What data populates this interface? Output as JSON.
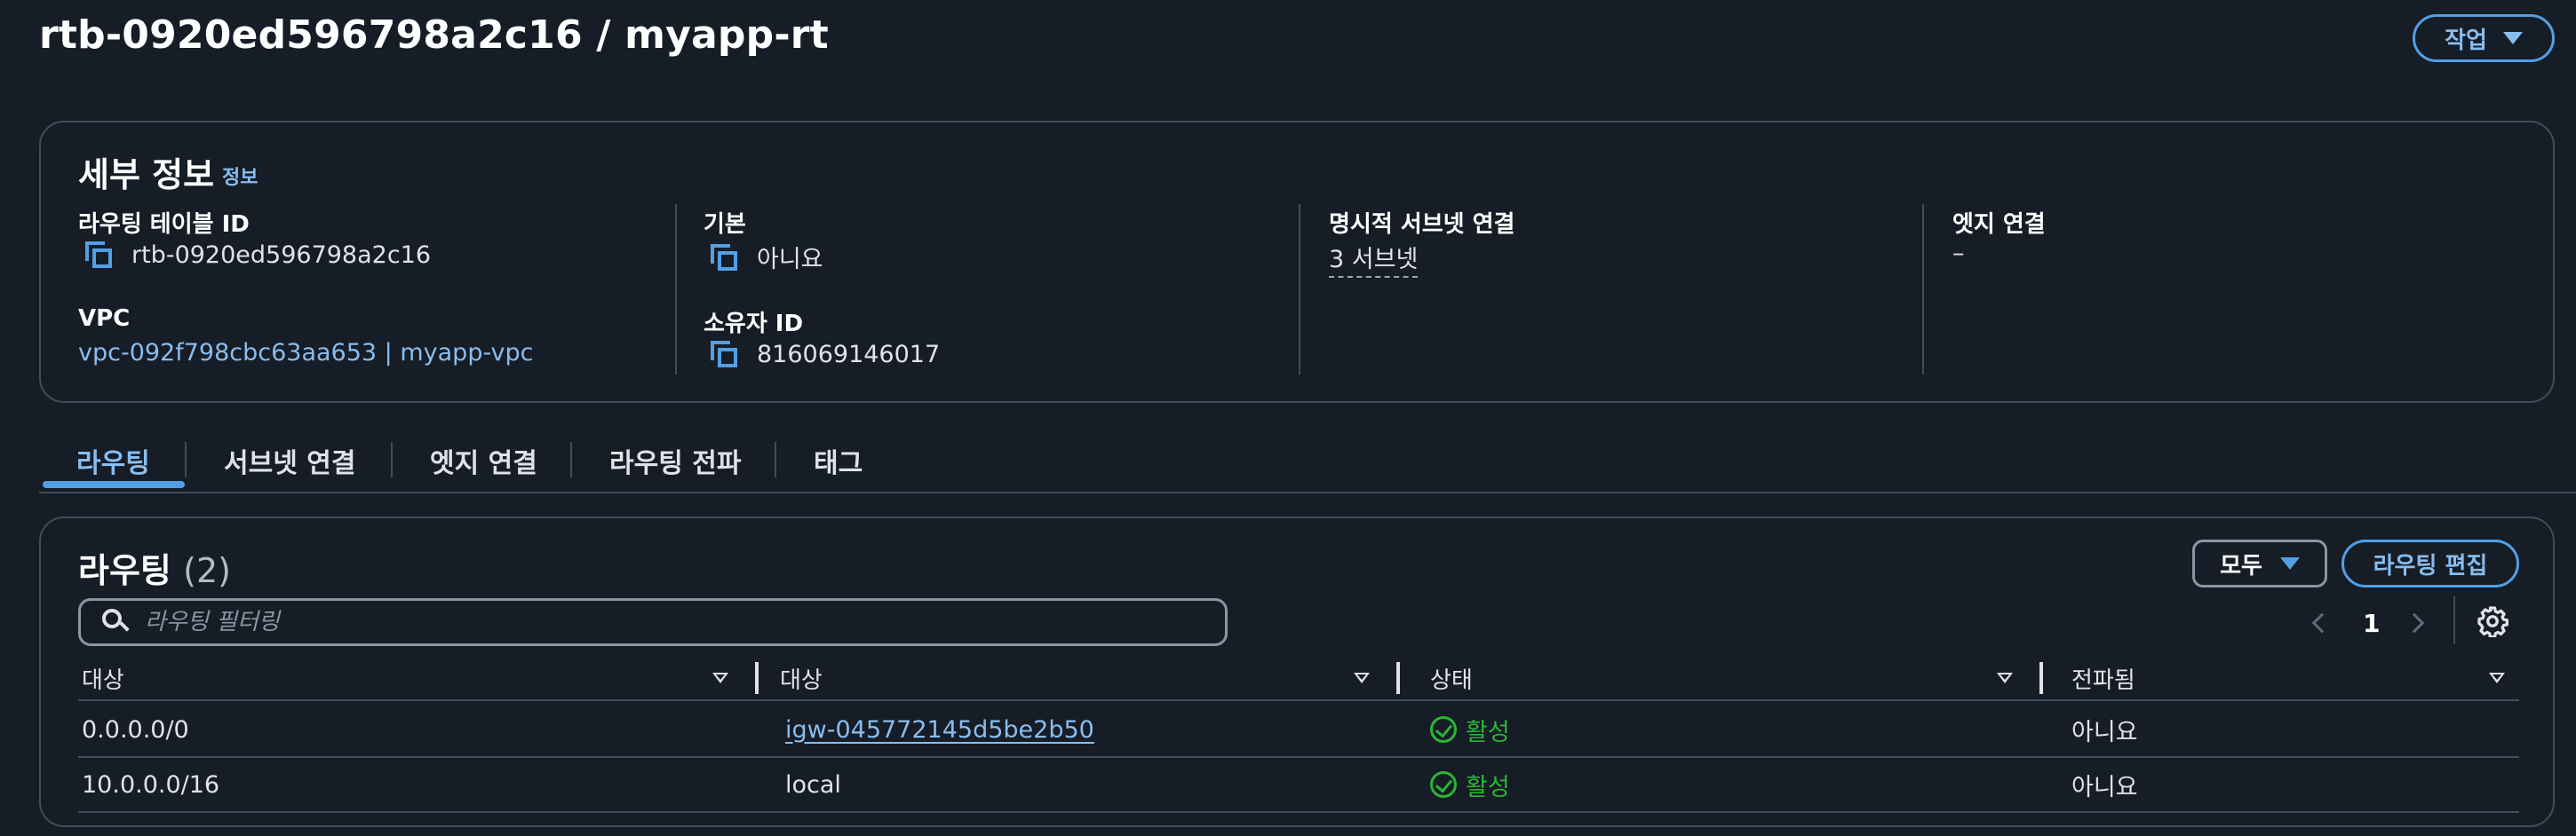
{
  "page": {
    "title": "rtb-0920ed596798a2c16 / myapp-rt",
    "actions_label": "작업"
  },
  "details": {
    "title": "세부 정보",
    "info_link": "정보",
    "route_table_id_label": "라우팅 테이블 ID",
    "route_table_id_value": "rtb-0920ed596798a2c16",
    "main_label": "기본",
    "main_value": "아니요",
    "explicit_subnets_label": "명시적 서브넷 연결",
    "explicit_subnets_value": "3 서브넷",
    "edge_assoc_label": "엣지 연결",
    "edge_assoc_value": "–",
    "vpc_label": "VPC",
    "vpc_value": "vpc-092f798cbc63aa653 | myapp-vpc",
    "owner_id_label": "소유자 ID",
    "owner_id_value": "816069146017"
  },
  "tabs": [
    {
      "label": "라우팅"
    },
    {
      "label": "서브넷 연결"
    },
    {
      "label": "엣지 연결"
    },
    {
      "label": "라우팅 전파"
    },
    {
      "label": "태그"
    }
  ],
  "routes": {
    "title": "라우팅",
    "count": "(2)",
    "filter_select": "모두",
    "edit_label": "라우팅 편집",
    "filter_placeholder": "라우팅 필터링",
    "page_number": "1",
    "columns": [
      "대상",
      "대상",
      "상태",
      "전파됨"
    ],
    "rows": [
      {
        "destination": "0.0.0.0/0",
        "target": "igw-045772145d5be2b50",
        "target_is_link": true,
        "status": "활성",
        "propagated": "아니요"
      },
      {
        "destination": "10.0.0.0/16",
        "target": "local",
        "target_is_link": false,
        "status": "활성",
        "propagated": "아니요"
      }
    ]
  },
  "colors": {
    "background": "#161d26",
    "link": "#89bdee",
    "accent": "#539fe5",
    "success": "#2bb534",
    "border": "#414d5c"
  }
}
